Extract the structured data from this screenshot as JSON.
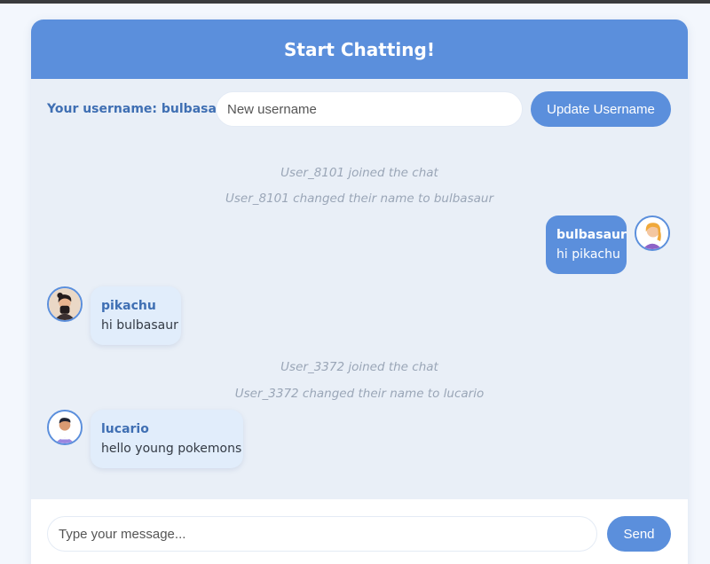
{
  "header": {
    "title": "Start Chatting!"
  },
  "user_bar": {
    "username_label": "Your username: bulbasaur",
    "input_placeholder": "New username",
    "update_button": "Update Username"
  },
  "messages": [
    {
      "kind": "system",
      "text": "User_8101 joined the chat"
    },
    {
      "kind": "system",
      "text": "User_8101 changed their name to bulbasaur"
    },
    {
      "kind": "own",
      "author": "bulbasaur",
      "text": "hi pikachu",
      "avatar": "avatar-blonde-woman"
    },
    {
      "kind": "other",
      "author": "pikachu",
      "text": "hi bulbasaur",
      "avatar": "avatar-dark-haired-woman"
    },
    {
      "kind": "system",
      "text": "User_3372 joined the chat"
    },
    {
      "kind": "system",
      "text": "User_3372 changed their name to lucario"
    },
    {
      "kind": "other",
      "author": "lucario",
      "text": "hello young pokemons",
      "avatar": "avatar-man-striped-shirt"
    }
  ],
  "composer": {
    "input_placeholder": "Type your message...",
    "send_button": "Send"
  },
  "colors": {
    "accent": "#5b8fdc",
    "background": "#e9eff7",
    "label": "#3f6fb3",
    "system_text": "#9aa6b7"
  }
}
